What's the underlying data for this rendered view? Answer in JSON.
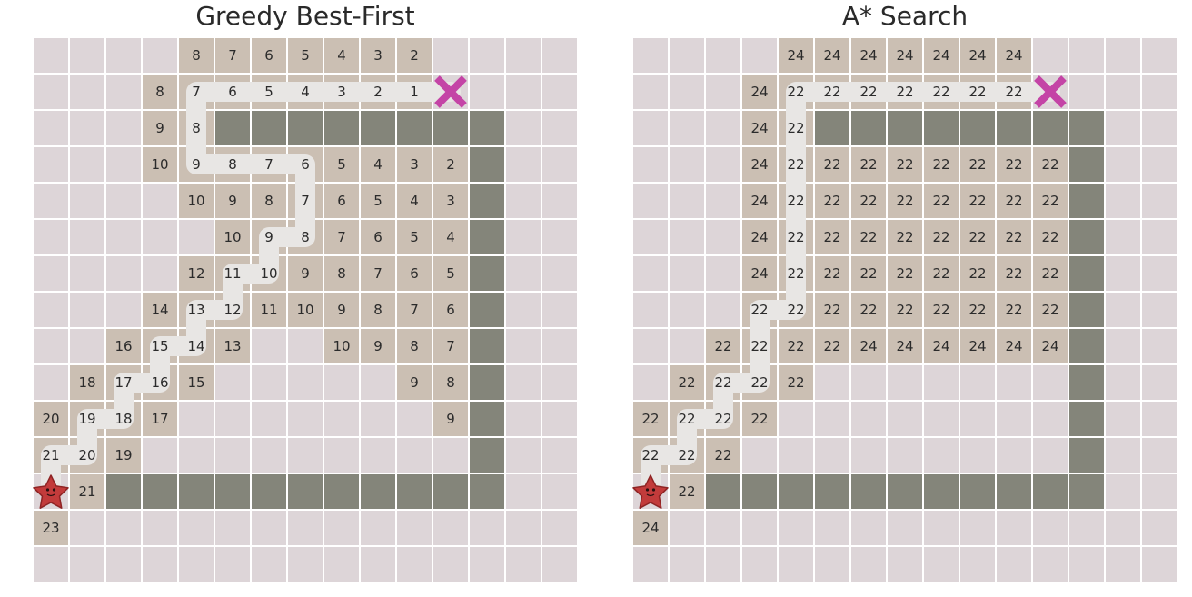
{
  "panels": [
    {
      "id": "greedy",
      "title": "Greedy Best-First",
      "rows": [
        "....8765432...",
        "...87654321X..",
        "...98#########",
        "...1098765432#",
        "....109876543#",
        ".....10987654#",
        ".....121110987654#",
        "",
        "",
        "",
        "",
        "",
        "",
        "",
        ""
      ],
      "cells": [
        [
          null,
          null,
          null,
          null,
          "8",
          "7",
          "6",
          "5",
          "4",
          "3",
          "2",
          null,
          null,
          null,
          null
        ],
        [
          null,
          null,
          null,
          "8",
          "7",
          "6",
          "5",
          "4",
          "3",
          "2",
          "1",
          "X",
          null,
          null,
          null
        ],
        [
          null,
          null,
          null,
          "9",
          "8",
          "#",
          "#",
          "#",
          "#",
          "#",
          "#",
          "#",
          "#",
          null,
          null
        ],
        [
          null,
          null,
          null,
          "10",
          "9",
          "8",
          "7",
          "6",
          "5",
          "4",
          "3",
          "2",
          "#",
          null,
          null
        ],
        [
          null,
          null,
          null,
          null,
          "10",
          "9",
          "8",
          "7",
          "6",
          "5",
          "4",
          "3",
          "#",
          null,
          null
        ],
        [
          null,
          null,
          null,
          null,
          null,
          "10",
          "9",
          "8",
          "7",
          "6",
          "5",
          "4",
          "#",
          null,
          null
        ],
        [
          null,
          null,
          null,
          null,
          "12",
          "11",
          "10",
          "9",
          "8",
          "7",
          "6",
          "5",
          "#",
          null,
          null
        ],
        [
          null,
          null,
          null,
          "14",
          "13",
          "12",
          "11",
          "10",
          "9",
          "8",
          "7",
          "6",
          "#",
          null,
          null
        ],
        [
          null,
          null,
          "16",
          "15",
          "14",
          "13",
          null,
          null,
          "10",
          "9",
          "8",
          "7",
          "#",
          null,
          null
        ],
        [
          null,
          "18",
          "17",
          "16",
          "15",
          null,
          null,
          null,
          null,
          null,
          "9",
          "8",
          "#",
          null,
          null
        ],
        [
          "20",
          "19",
          "18",
          "17",
          null,
          null,
          null,
          null,
          null,
          null,
          null,
          "9",
          "#",
          null,
          null
        ],
        [
          "21",
          "20",
          "19",
          null,
          null,
          null,
          null,
          null,
          null,
          null,
          null,
          null,
          "#",
          null,
          null
        ],
        [
          "S",
          "21",
          "#",
          "#",
          "#",
          "#",
          "#",
          "#",
          "#",
          "#",
          "#",
          "#",
          "#",
          null,
          null
        ],
        [
          "23",
          null,
          null,
          null,
          null,
          null,
          null,
          null,
          null,
          null,
          null,
          null,
          null,
          null,
          null
        ],
        [
          null,
          null,
          null,
          null,
          null,
          null,
          null,
          null,
          null,
          null,
          null,
          null,
          null,
          null,
          null
        ]
      ],
      "path": [
        [
          12,
          0
        ],
        [
          11,
          0
        ],
        [
          11,
          1
        ],
        [
          10,
          1
        ],
        [
          10,
          2
        ],
        [
          9,
          2
        ],
        [
          9,
          3
        ],
        [
          8,
          3
        ],
        [
          8,
          4
        ],
        [
          7,
          4
        ],
        [
          7,
          5
        ],
        [
          6,
          5
        ],
        [
          6,
          6
        ],
        [
          5,
          6
        ],
        [
          5,
          7
        ],
        [
          4,
          7
        ],
        [
          3,
          7
        ],
        [
          3,
          6
        ],
        [
          3,
          5
        ],
        [
          3,
          4
        ],
        [
          2,
          4
        ],
        [
          1,
          4
        ],
        [
          1,
          5
        ],
        [
          1,
          6
        ],
        [
          1,
          7
        ],
        [
          1,
          8
        ],
        [
          1,
          9
        ],
        [
          1,
          10
        ],
        [
          1,
          11
        ]
      ]
    },
    {
      "id": "astar",
      "title": "A* Search",
      "cells": [
        [
          null,
          null,
          null,
          null,
          "24",
          "24",
          "24",
          "24",
          "24",
          "24",
          "24",
          null,
          null,
          null,
          null
        ],
        [
          null,
          null,
          null,
          "24",
          "22",
          "22",
          "22",
          "22",
          "22",
          "22",
          "22",
          "X",
          null,
          null,
          null
        ],
        [
          null,
          null,
          null,
          "24",
          "22",
          "#",
          "#",
          "#",
          "#",
          "#",
          "#",
          "#",
          "#",
          null,
          null
        ],
        [
          null,
          null,
          null,
          "24",
          "22",
          "22",
          "22",
          "22",
          "22",
          "22",
          "22",
          "22",
          "#",
          null,
          null
        ],
        [
          null,
          null,
          null,
          "24",
          "22",
          "22",
          "22",
          "22",
          "22",
          "22",
          "22",
          "22",
          "#",
          null,
          null
        ],
        [
          null,
          null,
          null,
          "24",
          "22",
          "22",
          "22",
          "22",
          "22",
          "22",
          "22",
          "22",
          "#",
          null,
          null
        ],
        [
          null,
          null,
          null,
          "24",
          "22",
          "22",
          "22",
          "22",
          "22",
          "22",
          "22",
          "22",
          "#",
          null,
          null
        ],
        [
          null,
          null,
          null,
          "22",
          "22",
          "22",
          "22",
          "22",
          "22",
          "22",
          "22",
          "22",
          "#",
          null,
          null
        ],
        [
          null,
          null,
          "22",
          "22",
          "22",
          "22",
          "24",
          "24",
          "24",
          "24",
          "24",
          "24",
          "#",
          null,
          null
        ],
        [
          null,
          "22",
          "22",
          "22",
          "22",
          null,
          null,
          null,
          null,
          null,
          null,
          null,
          "#",
          null,
          null
        ],
        [
          "22",
          "22",
          "22",
          "22",
          null,
          null,
          null,
          null,
          null,
          null,
          null,
          null,
          "#",
          null,
          null
        ],
        [
          "22",
          "22",
          "22",
          null,
          null,
          null,
          null,
          null,
          null,
          null,
          null,
          null,
          "#",
          null,
          null
        ],
        [
          "S",
          "22",
          "#",
          "#",
          "#",
          "#",
          "#",
          "#",
          "#",
          "#",
          "#",
          "#",
          "#",
          null,
          null
        ],
        [
          "24",
          null,
          null,
          null,
          null,
          null,
          null,
          null,
          null,
          null,
          null,
          null,
          null,
          null,
          null
        ],
        [
          null,
          null,
          null,
          null,
          null,
          null,
          null,
          null,
          null,
          null,
          null,
          null,
          null,
          null,
          null
        ]
      ],
      "path": [
        [
          12,
          0
        ],
        [
          11,
          0
        ],
        [
          11,
          1
        ],
        [
          10,
          1
        ],
        [
          10,
          2
        ],
        [
          9,
          2
        ],
        [
          9,
          3
        ],
        [
          8,
          3
        ],
        [
          7,
          3
        ],
        [
          7,
          4
        ],
        [
          6,
          4
        ],
        [
          5,
          4
        ],
        [
          4,
          4
        ],
        [
          3,
          4
        ],
        [
          2,
          4
        ],
        [
          1,
          4
        ],
        [
          1,
          5
        ],
        [
          1,
          6
        ],
        [
          1,
          7
        ],
        [
          1,
          8
        ],
        [
          1,
          9
        ],
        [
          1,
          10
        ],
        [
          1,
          11
        ]
      ]
    }
  ],
  "colors": {
    "empty": "#ddd5d8",
    "visited": "#cbbfb3",
    "wall": "#84857a",
    "gridline": "#ffffff",
    "path": "#e8e6e4",
    "goal": "#c444a6",
    "start": "#c23b3b",
    "text": "#2b2b2b"
  },
  "icons": {
    "start": "star-face-icon",
    "goal": "x-mark-icon"
  }
}
